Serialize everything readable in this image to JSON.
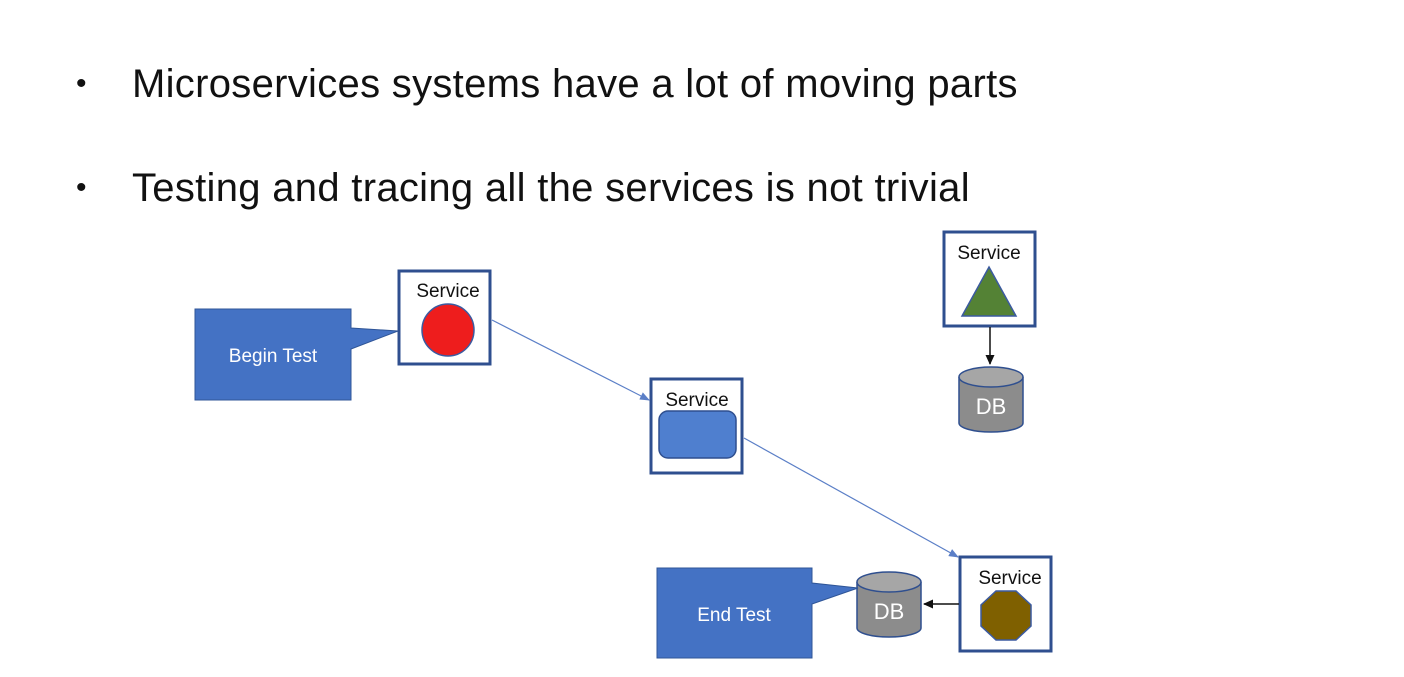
{
  "bullets": [
    {
      "text": "Microservices systems have a lot of moving parts"
    },
    {
      "text": "Testing and tracing all the services is not trivial"
    }
  ],
  "diagram": {
    "callouts": {
      "begin": "Begin Test",
      "end": "End Test"
    },
    "services": {
      "circle": "Service",
      "rounded": "Service",
      "triangle": "Service",
      "octagon": "Service"
    },
    "databases": {
      "top": "DB",
      "bottom": "DB"
    }
  },
  "colors": {
    "callout_fill": "#4472c4",
    "border": "#2f4f8f",
    "circle": "#ee1d1d",
    "rounded": "#4f7fcf",
    "triangle": "#548235",
    "octagon": "#7f6000",
    "db_fill": "#8c8c8c",
    "db_top": "#a6a6a6",
    "flow_line": "#5b7fc7"
  }
}
